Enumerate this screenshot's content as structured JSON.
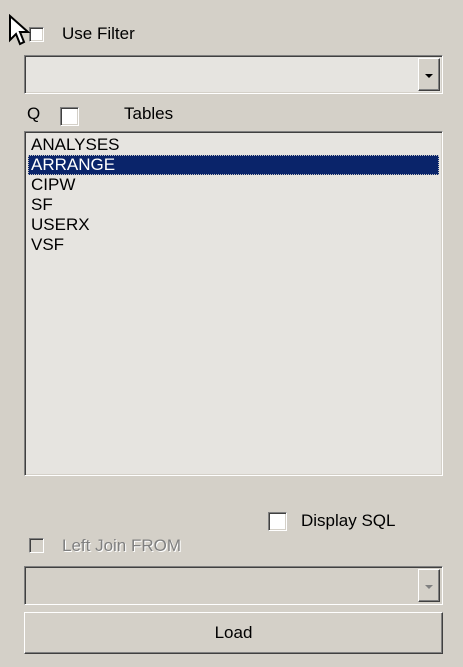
{
  "filter": {
    "use_filter_label": "Use Filter",
    "use_filter_checked": false,
    "combo_value": ""
  },
  "tables": {
    "q_label": "Q",
    "q_checked": false,
    "label": "Tables",
    "items": [
      "ANALYSES",
      "ARRANGE",
      "CIPW",
      "SF",
      "USERX",
      "VSF"
    ],
    "selected": "ARRANGE"
  },
  "options": {
    "display_sql_label": "Display SQL",
    "display_sql_checked": false,
    "left_join_label": "Left Join FROM",
    "left_join_checked": false,
    "left_join_enabled": false,
    "join_combo_value": ""
  },
  "load_button": "Load",
  "colors": {
    "face": "#d4d0c8",
    "field": "#e6e4e0",
    "selection": "#0a246a",
    "disabled_text": "#808080"
  },
  "cursor_icon": "arrow-cursor-icon"
}
